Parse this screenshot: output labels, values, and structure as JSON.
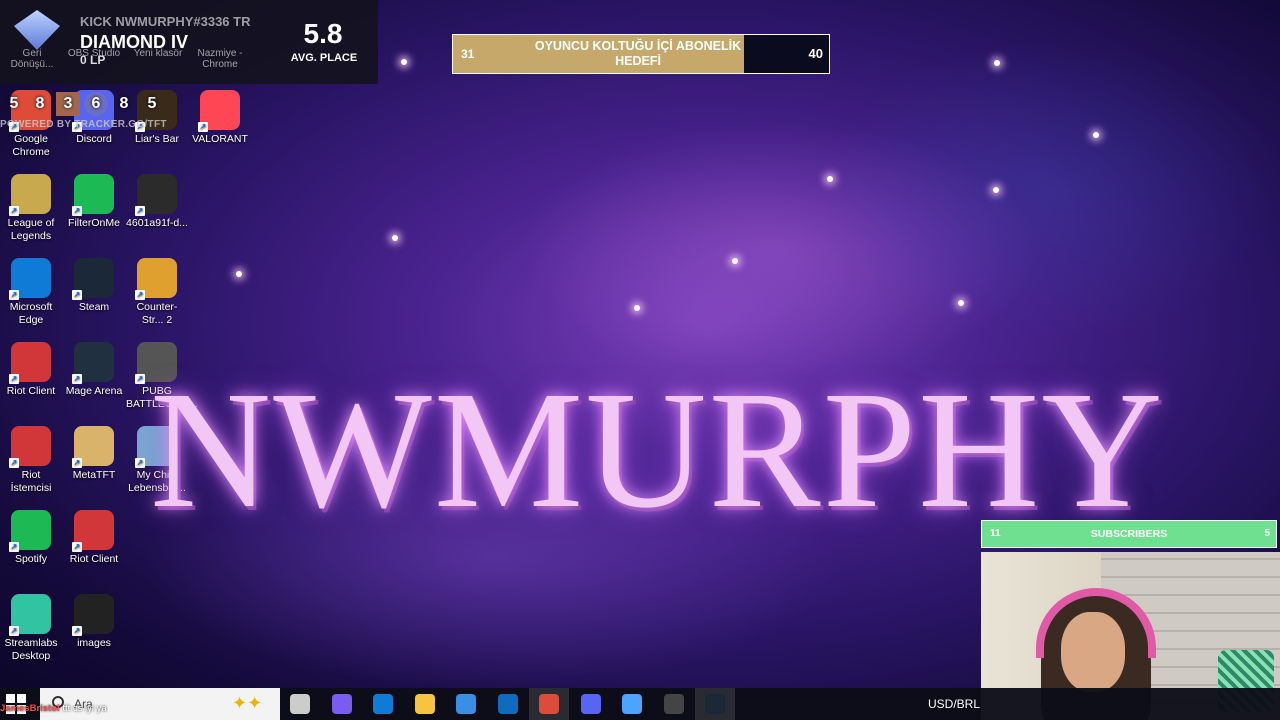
{
  "rank_overlay": {
    "summoner": "KICK NWMURPHY#3336 TR",
    "tier": "DIAMOND IV",
    "lp": "0 LP",
    "avg_place": "5.8",
    "avg_label": "AVG. PLACE",
    "recent_placements": [
      "5",
      "8",
      "3",
      "6",
      "8",
      "5"
    ],
    "powered_by": "POWERED BY TRACKER.GG/TFT",
    "ghost_icons": [
      {
        "label": "Geri Dönüşü..."
      },
      {
        "label": "OBS Studio"
      },
      {
        "label": "Yeni klasör"
      },
      {
        "label": "Nazmiye - Chrome"
      }
    ]
  },
  "sub_goal": {
    "title": "OYUNCU KOLTUĞU İÇİ ABONELİK HEDEFİ",
    "current": "31",
    "target": "40",
    "progress": 0.775
  },
  "stream_title": "NWMURPHY",
  "subscribers_goal": {
    "title": "SUBSCRIBERS",
    "current": "11",
    "target": "5"
  },
  "desktop_icons": [
    {
      "label": "Google Chrome",
      "icon": "chrome-icon",
      "color": "#dd4b39"
    },
    {
      "label": "Discord",
      "icon": "discord-icon",
      "color": "#5865f2"
    },
    {
      "label": "Liar's Bar",
      "icon": "liars-bar-icon",
      "color": "#3a2a1a"
    },
    {
      "label": "VALORANT",
      "icon": "valorant-icon",
      "color": "#ff4655"
    },
    {
      "label": "League of Legends",
      "icon": "league-icon",
      "color": "#c9a94e"
    },
    {
      "label": "FilterOnMe",
      "icon": "filteronme-icon",
      "color": "#1db954"
    },
    {
      "label": "4601a91f-d...",
      "icon": "image-file-icon",
      "color": "#2b2b2b"
    },
    {
      "label": "Microsoft Edge",
      "icon": "edge-icon",
      "color": "#0f7bd6"
    },
    {
      "label": "Steam",
      "icon": "steam-icon",
      "color": "#1b2838"
    },
    {
      "label": "Counter-Str... 2",
      "icon": "cs2-icon",
      "color": "#e0a030"
    },
    {
      "label": "Riot Client",
      "icon": "riot-icon",
      "color": "#d13639"
    },
    {
      "label": "Mage Arena",
      "icon": "mage-arena-icon",
      "color": "#203040"
    },
    {
      "label": "PUBG BATTLEGRO...",
      "icon": "pubg-icon",
      "color": "#555555"
    },
    {
      "label": "Riot İstemcisi",
      "icon": "riot-icon",
      "color": "#d13639"
    },
    {
      "label": "MetaTFT",
      "icon": "metatft-icon",
      "color": "#d9b36a"
    },
    {
      "label": "My Child Lebensbor...",
      "icon": "my-child-icon",
      "color": "#7aa5d0"
    },
    {
      "label": "Spotify",
      "icon": "spotify-icon",
      "color": "#1db954"
    },
    {
      "label": "Riot Client",
      "icon": "riot-icon",
      "color": "#d13639"
    },
    {
      "label": "Streamlabs Desktop",
      "icon": "streamlabs-icon",
      "color": "#31c3a2"
    },
    {
      "label": "images",
      "icon": "folder-image-icon",
      "color": "#222222"
    }
  ],
  "taskbar": {
    "search_placeholder": "Ara",
    "apps": [
      {
        "icon": "task-view-icon",
        "color": "#cccccc"
      },
      {
        "icon": "copilot-icon",
        "color": "#7b5cf0"
      },
      {
        "icon": "edge-icon",
        "color": "#0f7bd6"
      },
      {
        "icon": "file-explorer-icon",
        "color": "#f5c542"
      },
      {
        "icon": "store-icon",
        "color": "#3a8ee6"
      },
      {
        "icon": "outlook-icon",
        "color": "#0f6cbd"
      },
      {
        "icon": "chrome-icon",
        "color": "#dd4b39"
      },
      {
        "icon": "discord-icon",
        "color": "#5865f2"
      },
      {
        "icon": "app-icon",
        "color": "#4da3ff"
      },
      {
        "icon": "obs-icon",
        "color": "#444444"
      },
      {
        "icon": "steam-icon",
        "color": "#1b2838"
      }
    ],
    "tray_text": "USD/BRL"
  },
  "chat_overlay": {
    "user": "JamesBristol",
    "message": "tft cs iyi ya"
  }
}
